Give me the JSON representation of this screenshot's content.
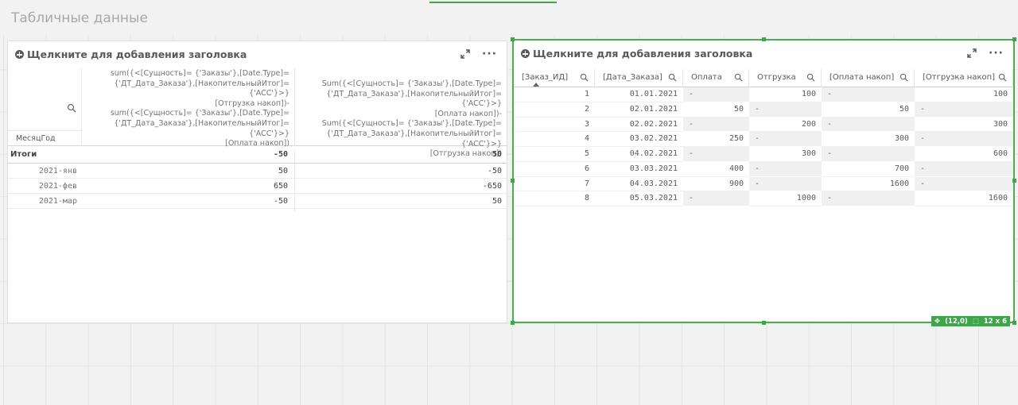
{
  "sheet": {
    "title": "Табличные данные"
  },
  "left_panel": {
    "title": "Щелкните для добавления заголовка",
    "dimension_label": "МесяцГод",
    "measure1_lines": [
      "sum({<[Сущность]= {'Заказы'},[Date.Type]=",
      "{'ДТ_Дата_Заказа'},[НакопительныйИтог]= {'ACC'}>}",
      "[Отгрузка накоп])-",
      "sum({<[Сущность]= {'Заказы'},[Date.Type]=",
      "{'ДТ_Дата_Заказа'},[НакопительныйИтог]= {'ACC'}>}",
      "[Оплата накоп])"
    ],
    "measure2_lines": [
      "Sum({<[Сущность]= {'Заказы'},[Date.Type]=",
      "{'ДТ_Дата_Заказа'},[НакопительныйИтог]= {'ACC'}>}",
      "[Оплата накоп])-",
      "Sum({<[Сущность]= {'Заказы'},[Date.Type]=",
      "{'ДТ_Дата_Заказа'},[НакопительныйИтог]= {'ACC'}>}",
      "[Отгрузка накоп])"
    ],
    "totals": {
      "label": "Итоги",
      "m1": "-50",
      "m2": "50"
    },
    "rows": [
      {
        "dim": "2021-янв",
        "m1": "50",
        "m2": "-50"
      },
      {
        "dim": "2021-фев",
        "m1": "650",
        "m2": "-650"
      },
      {
        "dim": "2021-мар",
        "m1": "-50",
        "m2": "50"
      }
    ]
  },
  "right_panel": {
    "title": "Щелкните для добавления заголовка",
    "columns": [
      "[Заказ_ИД]",
      "[Дата_Заказа]",
      "Оплата",
      "Отгрузка",
      "[Оплата накоп]",
      "[Отгрузка накоп]"
    ],
    "rows": [
      [
        "1",
        "01.01.2021",
        "-",
        "100",
        "-",
        "100"
      ],
      [
        "2",
        "02.01.2021",
        "50",
        "-",
        "50",
        "-"
      ],
      [
        "3",
        "02.02.2021",
        "-",
        "200",
        "-",
        "300"
      ],
      [
        "4",
        "03.02.2021",
        "250",
        "-",
        "300",
        "-"
      ],
      [
        "5",
        "04.02.2021",
        "-",
        "300",
        "-",
        "600"
      ],
      [
        "6",
        "03.03.2021",
        "400",
        "-",
        "700",
        "-"
      ],
      [
        "7",
        "04.03.2021",
        "900",
        "-",
        "1600",
        "-"
      ],
      [
        "8",
        "05.03.2021",
        "-",
        "1000",
        "-",
        "1600"
      ]
    ],
    "badge": {
      "coords": "(12,0)",
      "size": "12 x 6"
    }
  },
  "colors": {
    "selection": "#4cae50",
    "null_cell": "#f0f0f0"
  },
  "icons": [
    "plus-circle-icon",
    "expand-icon",
    "more-icon",
    "search-icon",
    "sort-ascending-icon",
    "move-icon",
    "resize-icon"
  ]
}
